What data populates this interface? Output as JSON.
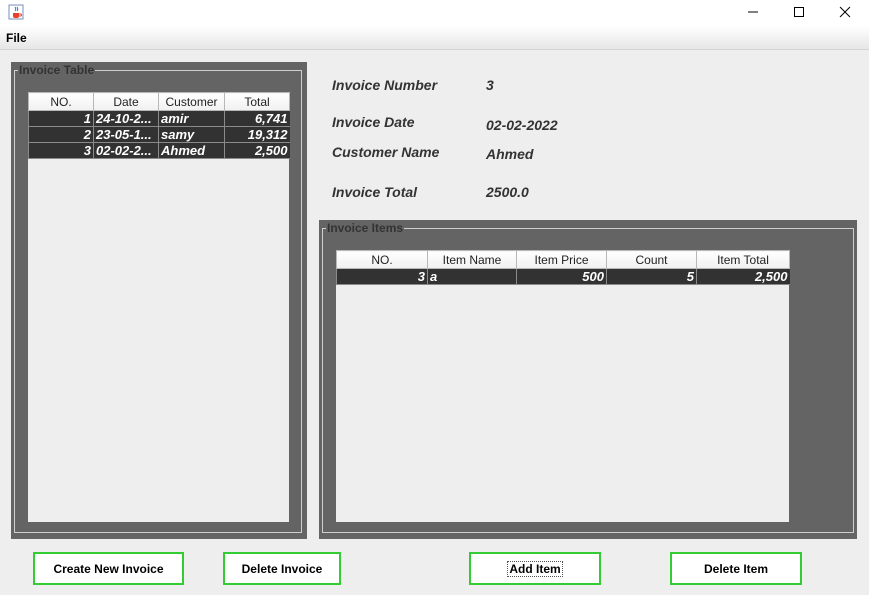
{
  "window": {
    "app_icon": "java-coffee-cup-icon",
    "minimize_icon": "minimize-icon",
    "maximize_icon": "maximize-icon",
    "close_icon": "close-icon"
  },
  "menu": {
    "file": "File"
  },
  "invoice_table": {
    "title": "Invoice Table",
    "columns": [
      "NO.",
      "Date",
      "Customer",
      "Total"
    ],
    "rows": [
      [
        "1",
        "24-10-2...",
        "amir",
        "6,741"
      ],
      [
        "2",
        "23-05-1...",
        "samy",
        "19,312"
      ],
      [
        "3",
        "02-02-2...",
        "Ahmed",
        "2,500"
      ]
    ]
  },
  "details": {
    "number_label": "Invoice Number",
    "number_value": "3",
    "date_label": "Invoice Date",
    "date_value": "02-02-2022",
    "customer_label": "Customer Name",
    "customer_value": "Ahmed",
    "total_label": "Invoice Total",
    "total_value": "2500.0"
  },
  "items_table": {
    "title": "Invoice Items",
    "columns": [
      "NO.",
      "Item Name",
      "Item Price",
      "Count",
      "Item Total"
    ],
    "rows": [
      [
        "3",
        "a",
        "500",
        "5",
        "2,500"
      ]
    ]
  },
  "buttons": {
    "create_invoice": "Create New Invoice",
    "delete_invoice": "Delete Invoice",
    "add_item": "Add Item",
    "delete_item": "Delete Item"
  },
  "colors": {
    "panel_bg": "#646464",
    "selected_row": "#323232",
    "button_border": "#33cc33"
  }
}
